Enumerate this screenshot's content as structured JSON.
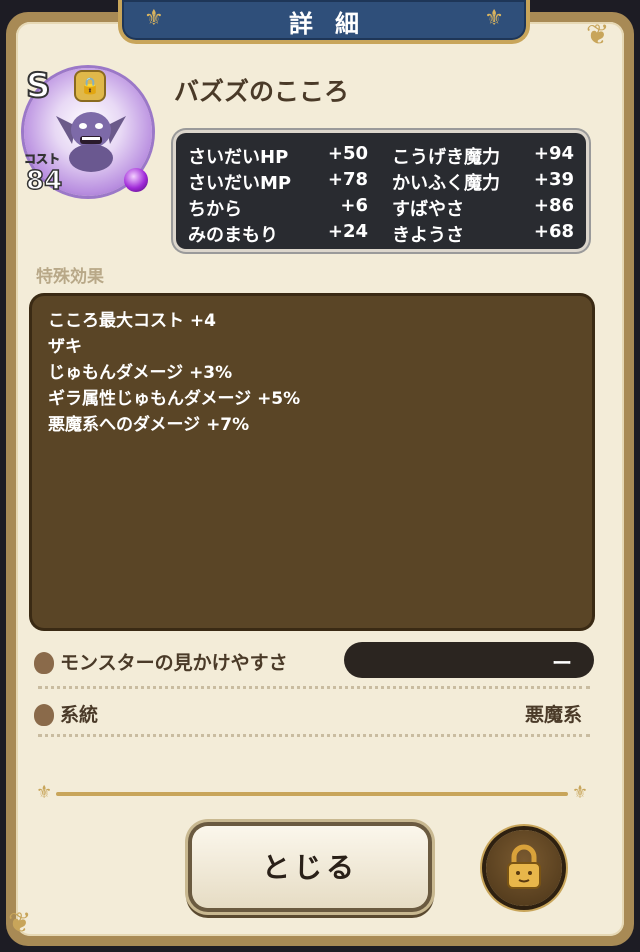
{
  "dialog": {
    "title": "詳細"
  },
  "monster": {
    "rank": "S",
    "name": "バズズのこころ",
    "cost_label": "コスト",
    "cost_value": "84"
  },
  "stats": {
    "left": [
      {
        "name": "さいだいHP",
        "value": "+50"
      },
      {
        "name": "さいだいMP",
        "value": "+78"
      },
      {
        "name": "ちから",
        "value": "+6"
      },
      {
        "name": "みのまもり",
        "value": "+24"
      }
    ],
    "right": [
      {
        "name": "こうげき魔力",
        "value": "+94"
      },
      {
        "name": "かいふく魔力",
        "value": "+39"
      },
      {
        "name": "すばやさ",
        "value": "+86"
      },
      {
        "name": "きようさ",
        "value": "+68"
      }
    ]
  },
  "special": {
    "label": "特殊効果",
    "effects": [
      "こころ最大コスト +4",
      "ザキ",
      "じゅもんダメージ +3%",
      "ギラ属性じゅもんダメージ +5%",
      "悪魔系へのダメージ +7%"
    ]
  },
  "info": {
    "visibility_label": "モンスターの見かけやすさ",
    "visibility_value": "ー",
    "family_label": "系統",
    "family_value": "悪魔系"
  },
  "buttons": {
    "close": "とじる"
  },
  "colors": {
    "panel": "#f3ecd8",
    "banner": "#2f4f7a",
    "gold": "#c8a55a",
    "effects_bg": "#5a4526",
    "stats_bg": "#292b30"
  },
  "icons": [
    "lock-icon",
    "fleur-icon",
    "drop-icon",
    "orb-icon"
  ]
}
